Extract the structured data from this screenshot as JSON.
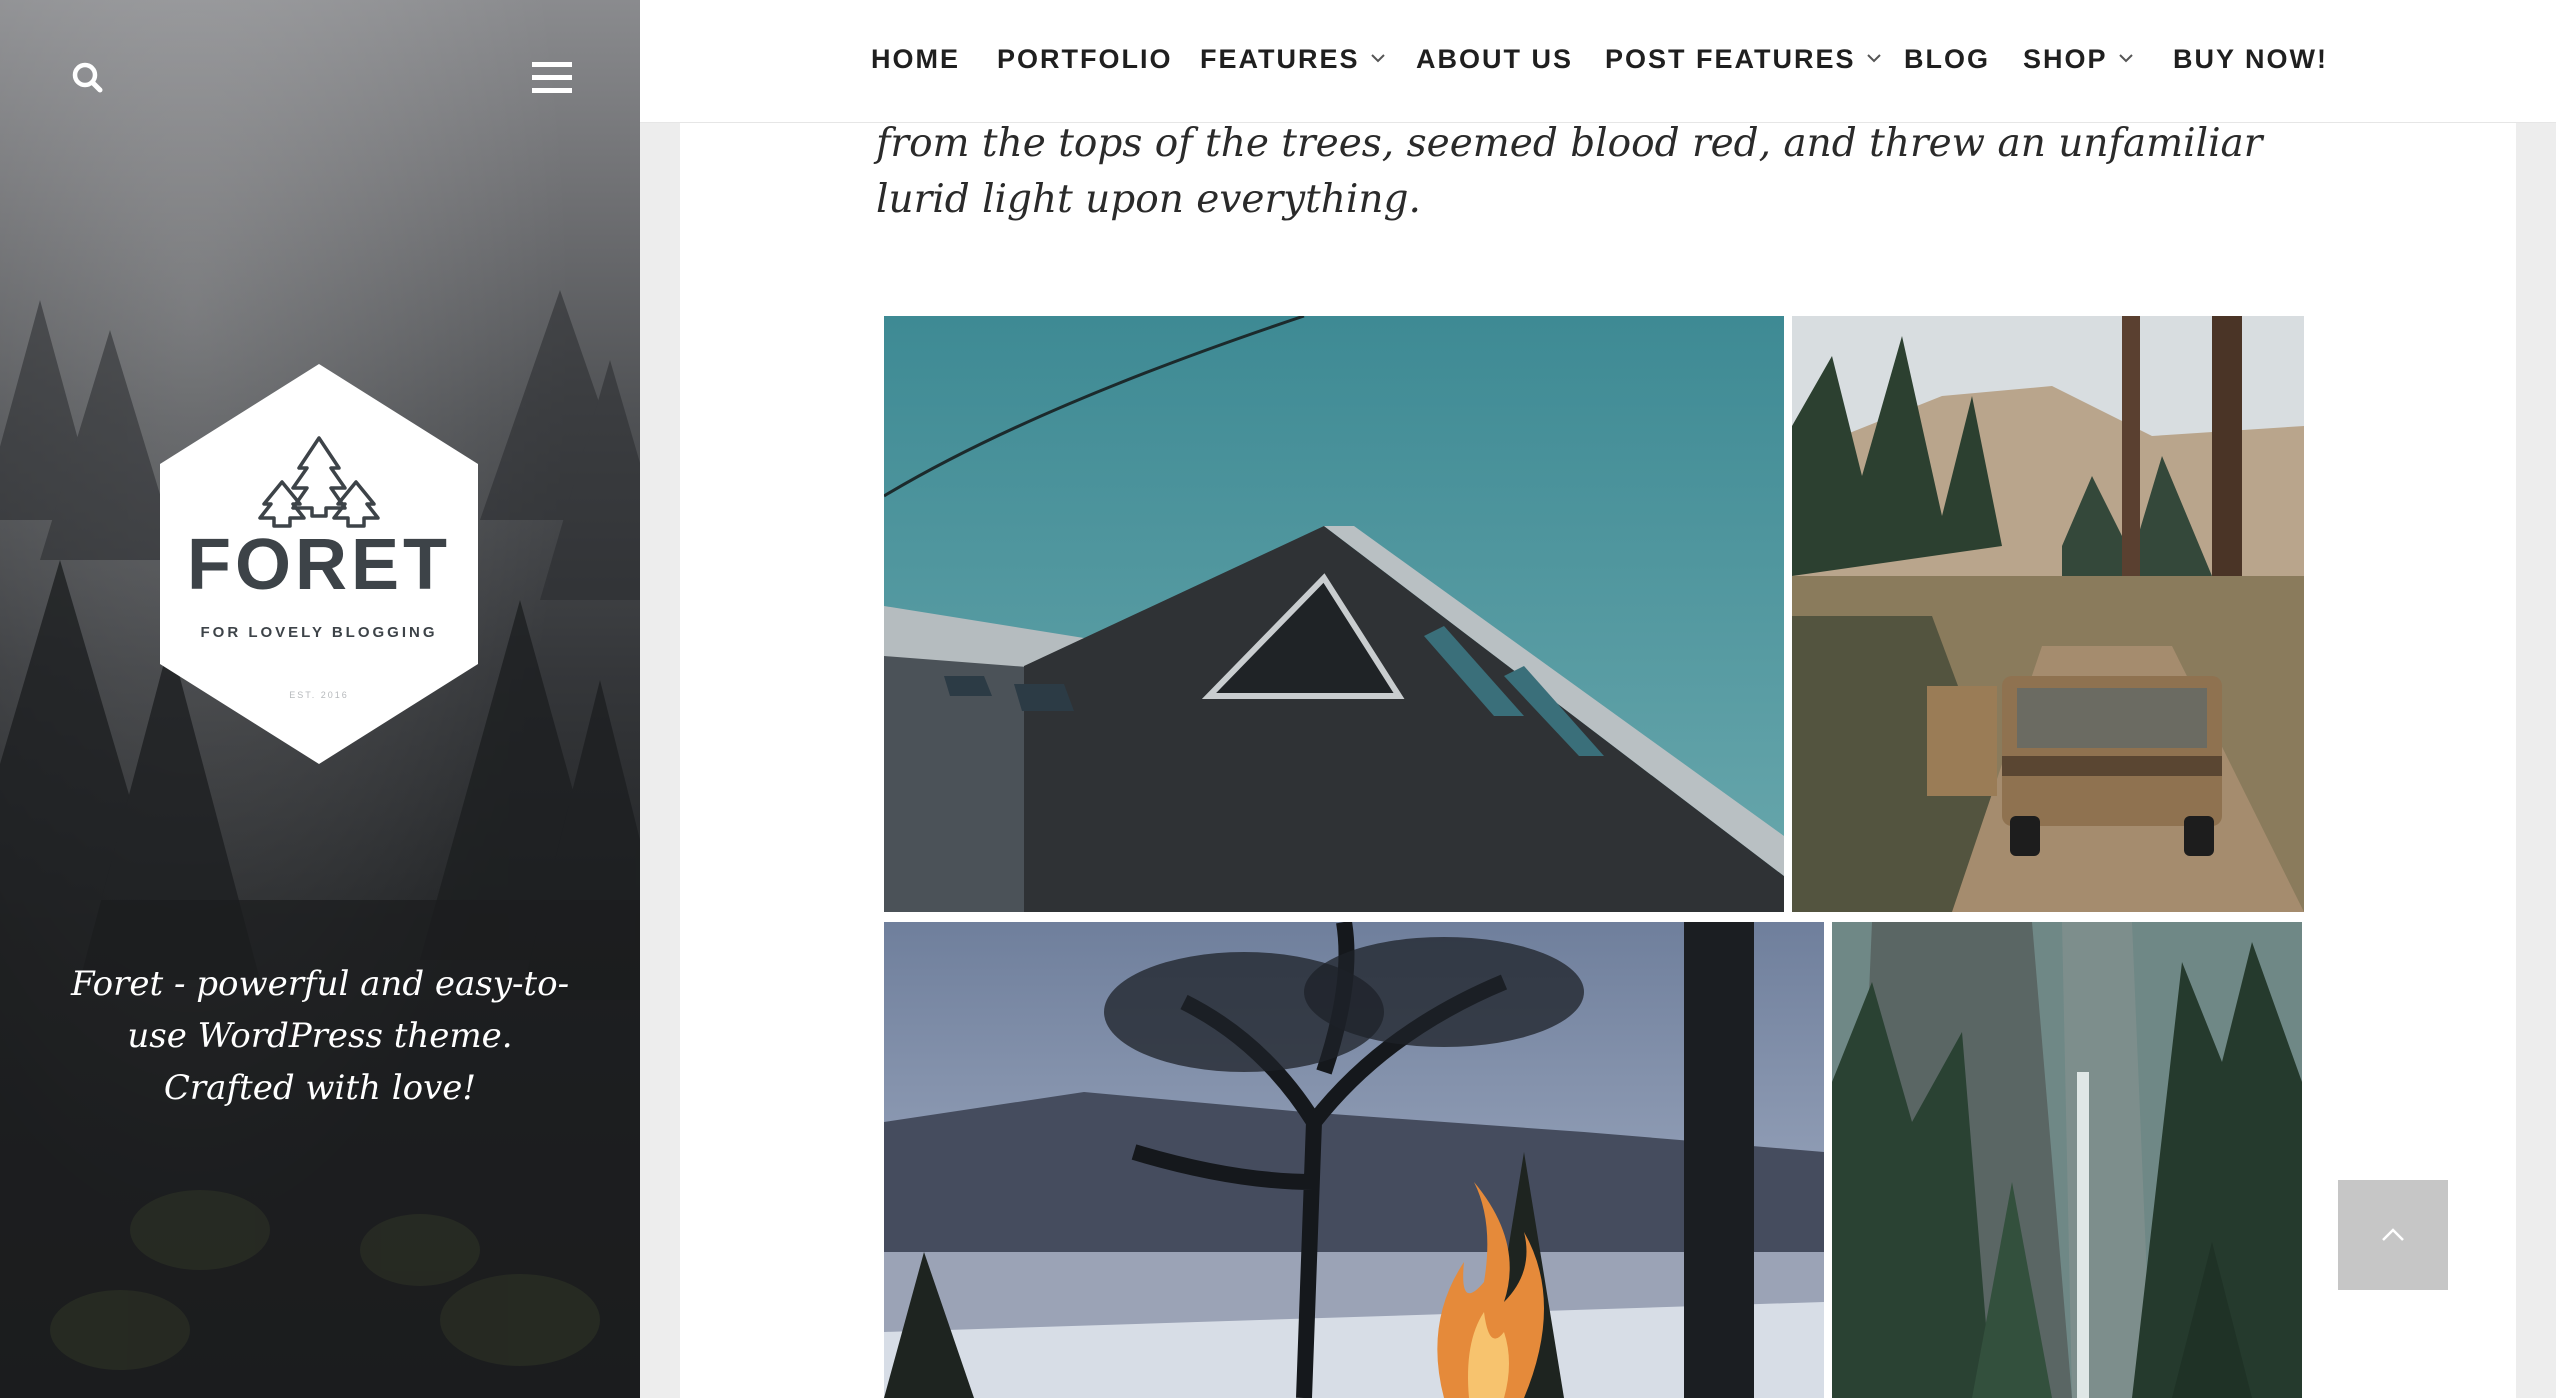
{
  "sidebar": {
    "search_icon": "search-icon",
    "menu_icon": "hamburger-menu-icon",
    "logo": {
      "title": "FORET",
      "tagline": "FOR LOVELY BLOGGING",
      "est": "EST. 2016",
      "icon": "three-pine-trees-icon"
    },
    "description": "Foret - powerful and easy-to-use WordPress theme. Crafted with love!"
  },
  "nav": {
    "items": [
      {
        "label": "HOME",
        "has_dropdown": false
      },
      {
        "label": "PORTFOLIO",
        "has_dropdown": false
      },
      {
        "label": "FEATURES",
        "has_dropdown": true
      },
      {
        "label": "ABOUT US",
        "has_dropdown": false
      },
      {
        "label": "POST FEATURES",
        "has_dropdown": true
      },
      {
        "label": "BLOG",
        "has_dropdown": false
      },
      {
        "label": "SHOP",
        "has_dropdown": true
      },
      {
        "label": "BUY NOW!",
        "has_dropdown": false
      }
    ]
  },
  "post": {
    "text": "from the tops of the trees, seemed blood red, and threw an unfamiliar lurid light upon everything."
  },
  "gallery": {
    "images": [
      {
        "subject": "dark wooden cabin with triangular window under teal sky"
      },
      {
        "subject": "vintage van on a dirt road through pine forest"
      },
      {
        "subject": "campfire by a lake under a large pine tree"
      },
      {
        "subject": "waterfall in a misty pine forest canyon"
      }
    ]
  },
  "back_to_top": {
    "icon": "chevron-up-icon"
  },
  "colors": {
    "sidebar_dark": "#1c1d1f",
    "nav_text": "#1f1f1f",
    "logo_text": "#3d4348",
    "back_to_top_bg": "#c6c6c6"
  }
}
